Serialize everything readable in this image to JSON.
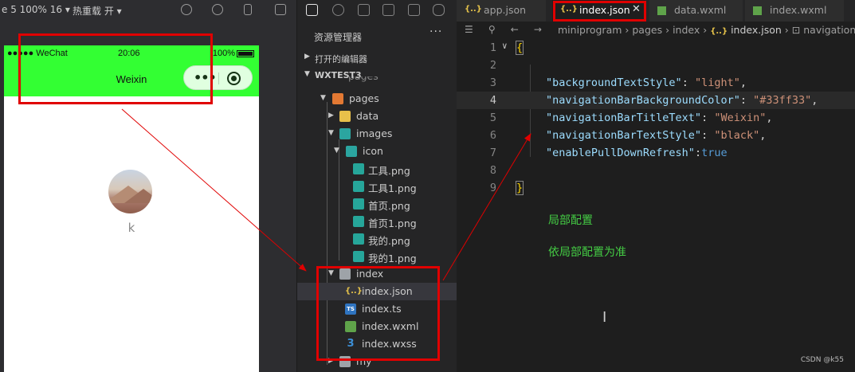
{
  "simulator": {
    "toolbar_device": "e 5 100% 16 ▾",
    "toolbar_hot": "热重载 开 ▾",
    "statusbar": {
      "signal": "●●●●● WeChat",
      "time": "20:06",
      "battery": "100%"
    },
    "navbar": {
      "title": "Weixin",
      "capsule_dots": "•••"
    },
    "profile": {
      "nickname": "k"
    }
  },
  "explorer": {
    "title": "资源管理器",
    "more": "···",
    "sections": {
      "open_editors": "打开的编辑器",
      "project": "WXTEST3"
    },
    "tree": {
      "partial_top": "pages",
      "pages": "pages",
      "data": "data",
      "images": "images",
      "icon": "icon",
      "files_png": [
        "工具.png",
        "工具1.png",
        "首页.png",
        "首页1.png",
        "我的.png",
        "我的1.png"
      ],
      "index": "index",
      "index_files": [
        "index.json",
        "index.ts",
        "index.wxml",
        "index.wxss"
      ],
      "my": "my"
    }
  },
  "editor": {
    "tabs": [
      {
        "label": "app.json",
        "icon": "{..}"
      },
      {
        "label": "index.json",
        "icon": "{..}",
        "active": true,
        "close": "✕"
      },
      {
        "label": "data.wxml",
        "icon": "wxml"
      },
      {
        "label": "index.wxml",
        "icon": "wxml"
      }
    ],
    "breadcrumb": {
      "root": "miniprogram",
      "sep": "›",
      "dir1": "pages",
      "dir2": "index",
      "file": "index.json",
      "symbol": "navigationB"
    },
    "lines": [
      {
        "n": "1",
        "fold": "∨",
        "text": "{"
      },
      {
        "n": "2",
        "text": ""
      },
      {
        "n": "3",
        "key": "\"backgroundTextStyle\"",
        "val": "\"light\"",
        "tail": ","
      },
      {
        "n": "4",
        "key": "\"navigationBarBackgroundColor\"",
        "val": "\"#33ff33\"",
        "tail": ","
      },
      {
        "n": "5",
        "key": "\"navigationBarTitleText\"",
        "val": "\"Weixin\"",
        "tail": ","
      },
      {
        "n": "6",
        "key": "\"navigationBarTextStyle\"",
        "val": "\"black\"",
        "tail": ","
      },
      {
        "n": "7",
        "key": "\"enablePullDownRefresh\"",
        "bool": "true",
        "tail": ""
      },
      {
        "n": "8",
        "text": ""
      },
      {
        "n": "9",
        "text": "}"
      }
    ],
    "notes": {
      "note1": "局部配置",
      "note2": "依局部配置为准"
    },
    "cursor": "I",
    "watermark": "CSDN @k55"
  },
  "colors": {
    "nav_green": "#33ff33",
    "annotation_red": "#e00000",
    "note_green": "#44cc44"
  }
}
